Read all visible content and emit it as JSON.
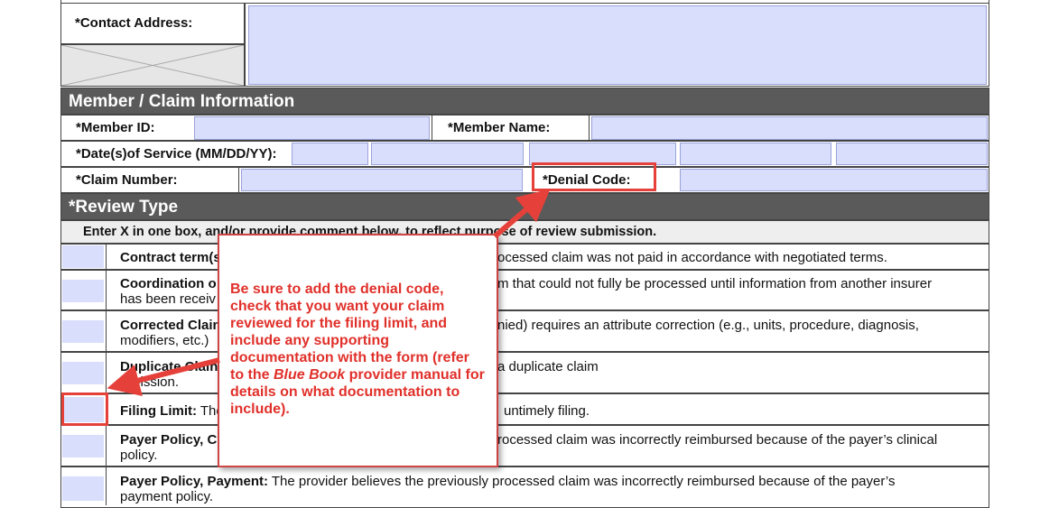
{
  "contact": {
    "address_label": "*Contact Address:"
  },
  "member_section": {
    "title": "Member / Claim Information",
    "member_id_label": "*Member ID:",
    "member_name_label": "*Member Name:",
    "dos_label": "*Date(s)of Service (MM/DD/YY):",
    "claim_number_label": "*Claim Number:",
    "denial_code_label": "*Denial Code:"
  },
  "review_section": {
    "title": "*Review Type",
    "instruction": "Enter X in one box, and/or provide comment below, to reflect purpose of review submission.",
    "rows": [
      {
        "bold": "Contract term(s",
        "start": "",
        "end": "ocessed claim was not paid in accordance with negotiated terms.",
        "end2": ""
      },
      {
        "bold": "Coordination o",
        "start": "has been receiv",
        "end": "m that could not fully be processed until information from another insurer",
        "end2": ""
      },
      {
        "bold": "Corrected Clain",
        "start": "modifiers, etc.)",
        "end": "nied) requires an attribute correction (e.g., units, procedure, diagnosis,",
        "end2": ""
      },
      {
        "bold": "Duplicate Clain",
        "start": "mission.",
        "end": "a duplicate claim",
        "end2": ""
      },
      {
        "bold": "Filing Limit:",
        "start": " The",
        "end": "untimely filing.",
        "end2": ""
      },
      {
        "bold": "Payer Policy, Cl",
        "start": "policy.",
        "end": "rocessed claim was incorrectly reimbursed because of the payer’s clinical",
        "end2": ""
      },
      {
        "bold": "Payer Policy, Payment:",
        "start": " The provider believes the previously processed claim was incorrectly reimbursed because of the payer’s",
        "end": "payment policy.",
        "end2": ""
      }
    ]
  },
  "callout": {
    "text_before": "Be sure to add the denial code, check that you want your claim reviewed for the filing limit, and include any supporting documentation with the form (refer to the ",
    "text_italic": "Blue Book",
    "text_after": " provider manual for details on what documentation to include)."
  },
  "colors": {
    "field": "#d9defc",
    "header": "#5a5a5a",
    "annotation": "#e5403a"
  }
}
